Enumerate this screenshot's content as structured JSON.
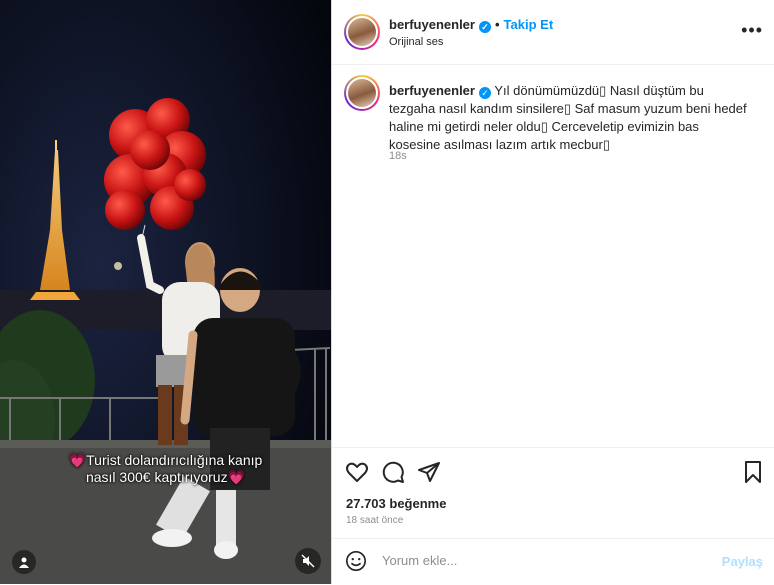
{
  "media": {
    "overlay_line1": "💗Turist dolandırıcılığına kanıp",
    "overlay_line2": "nasıl 300€ kaptırıyoruz💗"
  },
  "header": {
    "username": "berfuyenenler",
    "verified_icon": "verified-badge-icon",
    "separator": "•",
    "follow_label": "Takip Et",
    "audio_label": "Orijinal ses",
    "more_icon": "more-options-icon"
  },
  "caption": {
    "username": "berfuyenenler",
    "text": "Yıl dönümümüzdü▯ Nasıl düştüm bu tezgaha nasıl kandım sinsilere▯ Saf masum yuzum beni hedef haline mi getirdi neler oldu▯ Cerceveletip evimizin bas kosesine asılması lazım artık mecbur▯",
    "time": "18s"
  },
  "actions": {
    "like_icon": "heart-icon",
    "comment_icon": "comment-icon",
    "share_icon": "share-icon",
    "save_icon": "bookmark-icon"
  },
  "stats": {
    "likes": "27.703 beğenme",
    "posted": "18 saat önce"
  },
  "comment_box": {
    "placeholder": "Yorum ekle...",
    "post_label": "Paylaş",
    "emoji_icon": "emoji-icon"
  },
  "colors": {
    "accent": "#0095f6",
    "text": "#262626",
    "muted": "#8e8e8e",
    "post_disabled": "#b2dffc"
  }
}
